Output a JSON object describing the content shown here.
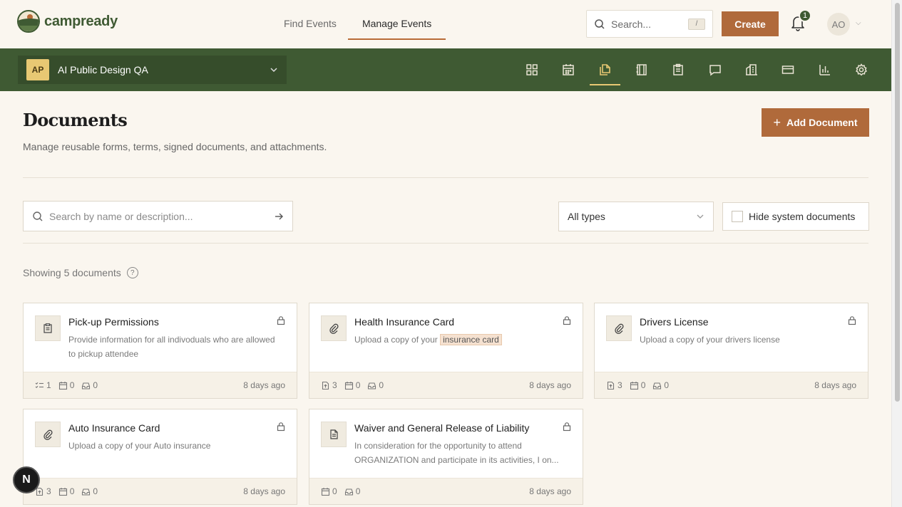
{
  "brand": {
    "name": "campready"
  },
  "nav": {
    "find_events": "Find Events",
    "manage_events": "Manage Events"
  },
  "header": {
    "search_placeholder": "Search...",
    "search_shortcut": "/",
    "create_label": "Create",
    "notification_count": "1",
    "avatar_initials": "AO"
  },
  "org": {
    "badge": "AP",
    "name": "AI Public Design QA"
  },
  "org_icons": [
    "dashboard-icon",
    "calendar-icon",
    "documents-icon",
    "notebook-icon",
    "clipboard-icon",
    "chat-icon",
    "building-icon",
    "credit-card-icon",
    "bar-chart-icon",
    "settings-icon"
  ],
  "page": {
    "title": "Documents",
    "description": "Manage reusable forms, terms, signed documents, and attachments.",
    "add_button": "Add Document"
  },
  "filters": {
    "search_placeholder": "Search by name or description...",
    "type_value": "All types",
    "hide_system_label": "Hide system documents"
  },
  "showing": "Showing 5 documents",
  "documents": [
    {
      "title": "Pick-up Permissions",
      "desc": "Provide information for all indivoduals who are allowed to pickup attendee",
      "icon": "clipboard-icon",
      "stats": [
        "1",
        "0",
        "0"
      ],
      "stat_icons": [
        "checklist-icon",
        "calendar-icon",
        "inbox-icon"
      ],
      "time": "8 days ago"
    },
    {
      "title": "Health Insurance Card",
      "desc_pre": "Upload a copy of your",
      "desc_hl": "insurance card",
      "icon": "paperclip-icon",
      "stats": [
        "3",
        "0",
        "0"
      ],
      "stat_icons": [
        "file-upload-icon",
        "calendar-icon",
        "inbox-icon"
      ],
      "time": "8 days ago"
    },
    {
      "title": "Drivers License",
      "desc": "Upload a copy of your drivers license",
      "icon": "paperclip-icon",
      "stats": [
        "3",
        "0",
        "0"
      ],
      "stat_icons": [
        "file-upload-icon",
        "calendar-icon",
        "inbox-icon"
      ],
      "time": "8 days ago"
    },
    {
      "title": "Auto Insurance Card",
      "desc": "Upload a copy of your Auto insurance",
      "icon": "paperclip-icon",
      "stats": [
        "3",
        "0",
        "0"
      ],
      "stat_icons": [
        "file-upload-icon",
        "calendar-icon",
        "inbox-icon"
      ],
      "time": "8 days ago"
    },
    {
      "title": "Waiver and General Release of Liability",
      "desc": "In consideration for the opportunity to attend ORGANIZATION and participate in its activities, I on...",
      "icon": "document-icon",
      "stats": [
        "0",
        "0"
      ],
      "stat_icons": [
        "calendar-icon",
        "inbox-icon"
      ],
      "time": "8 days ago"
    }
  ],
  "fab_label": "N"
}
